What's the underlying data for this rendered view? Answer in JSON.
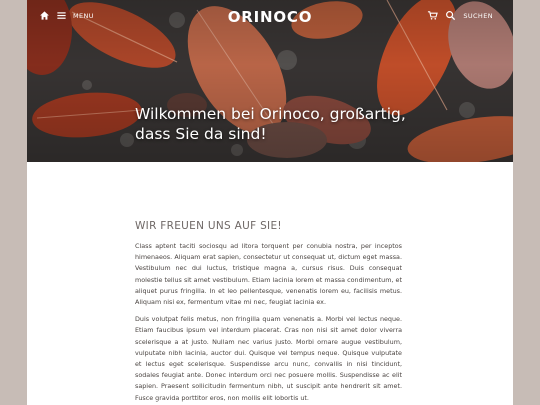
{
  "header": {
    "menu_label": "MENU",
    "logo": "ORINOCO",
    "search_label": "SUCHEN",
    "icons": [
      "home-icon",
      "hamburger-menu-icon",
      "cart-icon",
      "search-icon"
    ]
  },
  "hero": {
    "title": "Wilkommen bei Orinoco, großartig, dass Sie da sind!"
  },
  "main": {
    "heading": "WIR FREUEN UNS AUF SIE!",
    "paragraphs": [
      "Class aptent taciti sociosqu ad litora torquent per conubia nostra, per inceptos himenaeos. Aliquam erat sapien, consectetur ut consequat ut, dictum eget massa. Vestibulum nec dui luctus, tristique magna a, cursus risus. Duis consequat molestie tellus sit amet vestibulum. Etiam lacinia lorem et massa condimentum, et aliquet purus fringilla. In et leo pellentesque, venenatis lorem eu, facilisis metus. Aliquam nisi ex, fermentum vitae mi nec, feugiat lacinia ex.",
      "Duis volutpat felis metus, non fringilla quam venenatis a. Morbi vel lectus neque. Etiam faucibus ipsum vel interdum placerat. Cras non nisi sit amet dolor viverra scelerisque a at justo. Nullam nec varius justo. Morbi ornare augue vestibulum, vulputate nibh lacinia, auctor dui. Quisque vel tempus neque. Quisque vulputate et lectus eget scelerisque. Suspendisse arcu nunc, convallis in nisi tincidunt, sodales feugiat ante. Donec interdum orci nec posuere mollis. Suspendisse ac elit sapien. Praesent sollicitudin fermentum nibh, ut suscipit ante hendrerit sit amet. Fusce gravida porttitor eros, non mollis elit lobortis ut."
    ]
  },
  "colors": {
    "page_bg": "#c7bcb6",
    "content_bg": "#ffffff",
    "heading": "#6f6866",
    "body_text": "#4b4542",
    "leaf_orange": "#c7552d",
    "leaf_dark": "#7a2a1f"
  }
}
